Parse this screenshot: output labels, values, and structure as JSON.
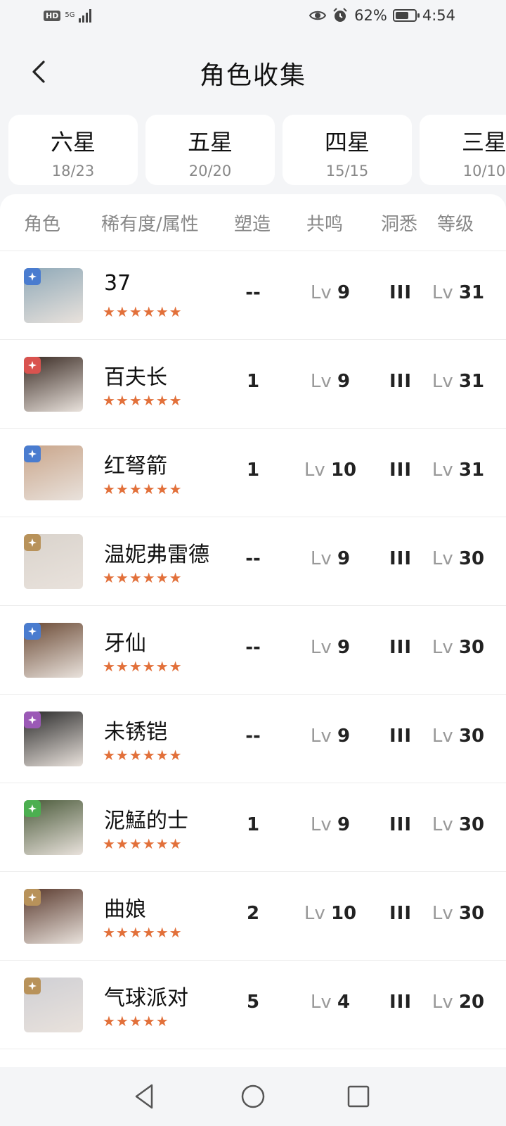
{
  "status": {
    "hd": "HD",
    "network": "5G",
    "battery": "62%",
    "time": "4:54"
  },
  "header": {
    "title": "角色收集"
  },
  "tiers": [
    {
      "name": "六星",
      "count": "18/23"
    },
    {
      "name": "五星",
      "count": "20/20"
    },
    {
      "name": "四星",
      "count": "15/15"
    },
    {
      "name": "三星",
      "count": "10/10"
    }
  ],
  "table": {
    "headers": {
      "role": "角色",
      "rarity": "稀有度/属性",
      "shaping": "塑造",
      "resonance": "共鸣",
      "insight": "洞悉",
      "level": "等级"
    },
    "lv_prefix": "Lv",
    "rows": [
      {
        "name": "37",
        "stars": "★★★★★★",
        "element_color": "#4a7ccf",
        "shaping": "--",
        "resonance": "9",
        "insight": "III",
        "level": "31"
      },
      {
        "name": "百夫长",
        "stars": "★★★★★★",
        "element_color": "#d9534f",
        "shaping": "1",
        "resonance": "9",
        "insight": "III",
        "level": "31"
      },
      {
        "name": "红弩箭",
        "stars": "★★★★★★",
        "element_color": "#4a7ccf",
        "shaping": "1",
        "resonance": "10",
        "insight": "III",
        "level": "31"
      },
      {
        "name": "温妮弗雷德",
        "stars": "★★★★★★",
        "element_color": "#b8925a",
        "shaping": "--",
        "resonance": "9",
        "insight": "III",
        "level": "30"
      },
      {
        "name": "牙仙",
        "stars": "★★★★★★",
        "element_color": "#4a7ccf",
        "shaping": "--",
        "resonance": "9",
        "insight": "III",
        "level": "30"
      },
      {
        "name": "未锈铠",
        "stars": "★★★★★★",
        "element_color": "#9b59b6",
        "shaping": "--",
        "resonance": "9",
        "insight": "III",
        "level": "30"
      },
      {
        "name": "泥鯭的士",
        "stars": "★★★★★★",
        "element_color": "#4caf50",
        "shaping": "1",
        "resonance": "9",
        "insight": "III",
        "level": "30"
      },
      {
        "name": "曲娘",
        "stars": "★★★★★★",
        "element_color": "#b8925a",
        "shaping": "2",
        "resonance": "10",
        "insight": "III",
        "level": "30"
      },
      {
        "name": "气球派对",
        "stars": "★★★★★",
        "element_color": "#b8925a",
        "shaping": "5",
        "resonance": "4",
        "insight": "III",
        "level": "20"
      }
    ]
  },
  "icons": {
    "back": "back-arrow-icon",
    "nav_back": "triangle-back-icon",
    "nav_home": "circle-home-icon",
    "nav_recent": "square-recent-icon"
  }
}
